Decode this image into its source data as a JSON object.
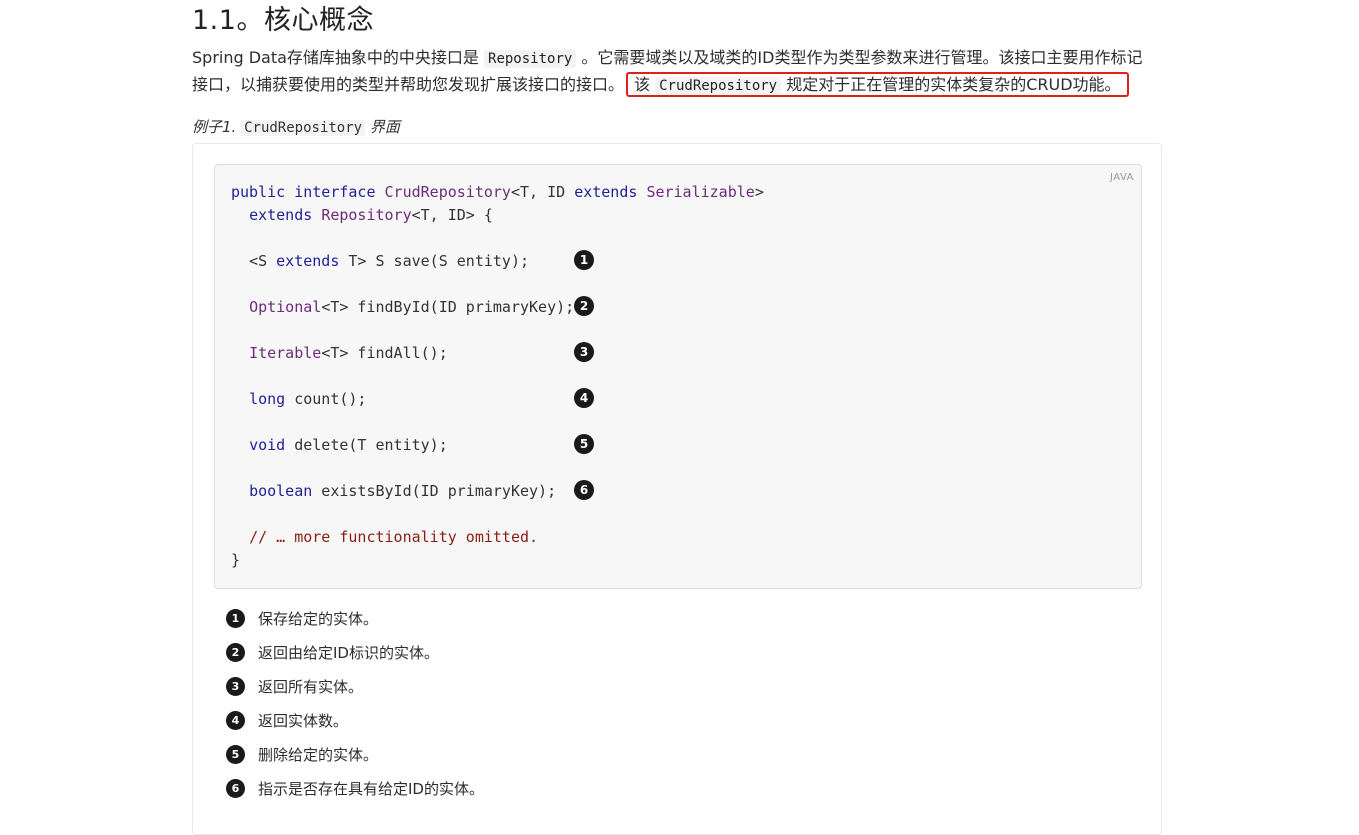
{
  "heading": "1.1。核心概念",
  "paragraph": {
    "part1": "Spring Data存储库抽象中的中央接口是 ",
    "code1": "Repository",
    "part2": " 。它需要域类以及域类的ID类型作为类型参数来进行管理。该接口主要用作标记接口，以捕获要使用的类型并帮助您发现扩展该接口的接口。",
    "highlight_pre": "该 ",
    "highlight_code": "CrudRepository",
    "highlight_post": " 规定对于正在管理的实体类复杂的CRUD功能。"
  },
  "example": {
    "caption_prefix": "例子1. ",
    "caption_code": "CrudRepository",
    "caption_suffix": " 界面",
    "lang": "JAVA"
  },
  "code": {
    "l1": {
      "kw1": "public",
      "kw2": "interface",
      "ty": "CrudRepository",
      "rest": "<T, ID ",
      "kw3": "extends",
      "ty2": "Serializable",
      "end": ">"
    },
    "l2": {
      "kw": "extends",
      "ty": "Repository",
      "rest": "<T, ID> {"
    },
    "l3": {
      "text": "<S ",
      "kw": "extends",
      "rest": " T> S save(S entity);"
    },
    "l4": {
      "ty": "Optional",
      "rest": "<T> findById(ID primaryKey);"
    },
    "l5": {
      "ty": "Iterable",
      "rest": "<T> findAll();"
    },
    "l6": {
      "kw": "long",
      "rest": " count();"
    },
    "l7": {
      "kw": "void",
      "rest": " delete(T entity);"
    },
    "l8": {
      "kw": "boolean",
      "rest": " existsById(ID primaryKey);"
    },
    "l9": {
      "comment": "// … more functionality omitted."
    },
    "l10": {
      "text": "}"
    }
  },
  "callouts": [
    "1",
    "2",
    "3",
    "4",
    "5",
    "6"
  ],
  "notes": [
    "保存给定的实体。",
    "返回由给定ID标识的实体。",
    "返回所有实体。",
    "返回实体数。",
    "删除给定的实体。",
    "指示是否存在具有给定ID的实体。"
  ],
  "colors": {
    "highlight_border": "#e0201c",
    "keyword": "#1f1f96",
    "type": "#6e2a7a",
    "comment": "#8a1f11"
  }
}
